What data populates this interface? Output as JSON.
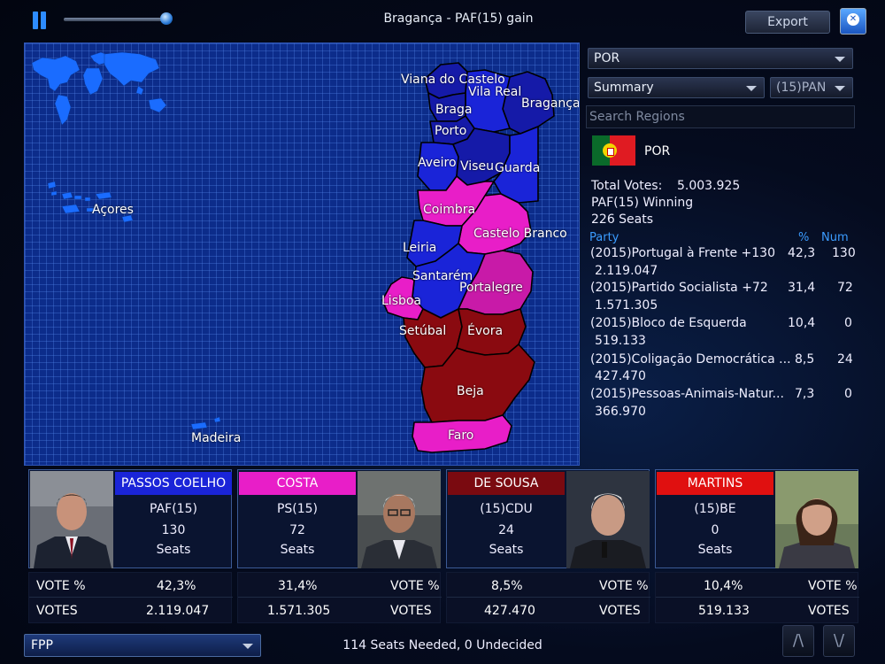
{
  "window": {
    "title": "Bragança - PAF(15) gain",
    "export_label": "Export"
  },
  "map": {
    "labels": [
      {
        "id": "viana",
        "text": "Viana do Castelo"
      },
      {
        "id": "vilareal",
        "text": "Vila Real"
      },
      {
        "id": "braga",
        "text": "Braga"
      },
      {
        "id": "braganca",
        "text": "Bragança"
      },
      {
        "id": "porto",
        "text": "Porto"
      },
      {
        "id": "aveiro",
        "text": "Aveiro"
      },
      {
        "id": "viseu",
        "text": "Viseu"
      },
      {
        "id": "guarda",
        "text": "Guarda"
      },
      {
        "id": "coimbra",
        "text": "Coimbra"
      },
      {
        "id": "castelobranco",
        "text": "Castelo Branco"
      },
      {
        "id": "leiria",
        "text": "Leiria"
      },
      {
        "id": "santarem",
        "text": "Santarém"
      },
      {
        "id": "portalegre",
        "text": "Portalegre"
      },
      {
        "id": "lisboa",
        "text": "Lisboa"
      },
      {
        "id": "setubal",
        "text": "Setúbal"
      },
      {
        "id": "evora",
        "text": "Évora"
      },
      {
        "id": "beja",
        "text": "Beja"
      },
      {
        "id": "faro",
        "text": "Faro"
      },
      {
        "id": "acores",
        "text": "Açores"
      },
      {
        "id": "madeira",
        "text": "Madeira"
      }
    ],
    "colors": {
      "paf_blue": "#1a24d8",
      "paf_dark": "#151aa8",
      "ps_pink": "#e81ec8",
      "ps_magenta": "#c81aa8",
      "red_dark": "#8a0a10",
      "ocean": "#0c2c8a",
      "world_land": "#1a6cff"
    }
  },
  "panel": {
    "country_select": "POR",
    "view_select": "Summary",
    "party_select": "(15)PAN",
    "search_placeholder": "Search Regions",
    "flag_label": "POR",
    "total_votes_label": "Total Votes:",
    "total_votes_value": "5.003.925",
    "winning_text": "PAF(15) Winning",
    "seats_text": "226 Seats",
    "col_party": "Party",
    "col_pct": "%",
    "col_num": "Num",
    "parties": [
      {
        "name": "(2015)Portugal à Frente +130",
        "votes": "2.119.047",
        "pct": "42,3",
        "num": "130"
      },
      {
        "name": "(2015)Partido Socialista +72",
        "votes": "1.571.305",
        "pct": "31,4",
        "num": "72"
      },
      {
        "name": "(2015)Bloco de Esquerda",
        "votes": "519.133",
        "pct": "10,4",
        "num": "0"
      },
      {
        "name": "(2015)Coligação Democrática ...",
        "votes": "427.470",
        "pct": "8,5",
        "num": "24"
      },
      {
        "name": "(2015)Pessoas-Animais-Natur...",
        "votes": "366.970",
        "pct": "7,3",
        "num": "0"
      }
    ]
  },
  "cards": [
    {
      "name": "PASSOS COELHO",
      "party": "PAF(15)",
      "seats": "130",
      "seats_label": "Seats",
      "color": "#1a24d8",
      "vote_pct_label": "VOTE %",
      "vote_pct": "42,3%",
      "votes_label": "VOTES",
      "votes": "2.119.047"
    },
    {
      "name": "COSTA",
      "party": "PS(15)",
      "seats": "72",
      "seats_label": "Seats",
      "color": "#e81ec8",
      "vote_pct_label": "VOTE %",
      "vote_pct": "31,4%",
      "votes_label": "VOTES",
      "votes": "1.571.305"
    },
    {
      "name": "DE SOUSA",
      "party": "(15)CDU",
      "seats": "24",
      "seats_label": "Seats",
      "color": "#7a0a10",
      "vote_pct_label": "VOTE %",
      "vote_pct": "8,5%",
      "votes_label": "VOTES",
      "votes": "427.470"
    },
    {
      "name": "MARTINS",
      "party": "(15)BE",
      "seats": "0",
      "seats_label": "Seats",
      "color": "#e01010",
      "vote_pct_label": "VOTE %",
      "vote_pct": "10,4%",
      "votes_label": "VOTES",
      "votes": "519.133"
    }
  ],
  "footer": {
    "system_select": "FPP",
    "status": "114 Seats Needed, 0 Undecided",
    "up_label": "/\\",
    "down_label": "\\/"
  }
}
